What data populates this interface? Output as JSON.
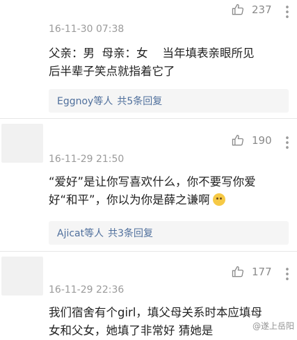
{
  "comments": [
    {
      "likes": "237",
      "time": "16-11-30 07:38",
      "content_line1": "父亲：男  母亲：女    当年填表亲眼所见",
      "content_line2": "后半辈子笑点就指着它了",
      "reply_user": "Eggnoy等人",
      "reply_count": "共5条回复"
    },
    {
      "likes": "190",
      "time": "16-11-29 21:50",
      "content_line1": "“爱好”是让你写喜欢什么，你不要写你爱",
      "content_line2": "好“和平”，你以为你是薛之谦啊",
      "reply_user": "Ajicat等人",
      "reply_count": "共3条回复"
    },
    {
      "likes": "177",
      "time": "16-11-29 22:36",
      "content_line1": "我们宿舍有个girl，填父母关系时本应填母",
      "content_line2": "女和父女，她填了非常好 猜她是"
    }
  ],
  "watermark": "@遂上岳阳"
}
